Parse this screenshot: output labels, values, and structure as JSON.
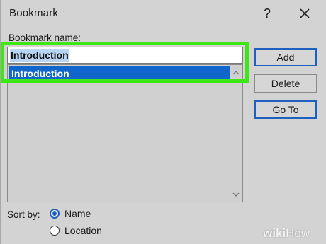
{
  "dialog": {
    "title": "Bookmark",
    "help_label": "?",
    "name_label": "Bookmark name:",
    "name_value": "Introduction",
    "list_items": [
      "Introduction"
    ],
    "buttons": {
      "add": "Add",
      "delete": "Delete",
      "goto": "Go To"
    },
    "sort_by_label": "Sort by:",
    "sort_options": [
      {
        "label": "Name",
        "checked": true
      },
      {
        "label": "Location",
        "checked": false
      }
    ]
  },
  "watermark": {
    "part1": "wiki",
    "part2": "How"
  },
  "colors": {
    "highlight_frame": "#3ee615",
    "selection": "#1166cc",
    "default_button_border": "#1f5fbf"
  },
  "icons": {
    "close": "close-icon",
    "scroll_up": "chevron-up-icon",
    "scroll_down": "chevron-down-icon"
  }
}
